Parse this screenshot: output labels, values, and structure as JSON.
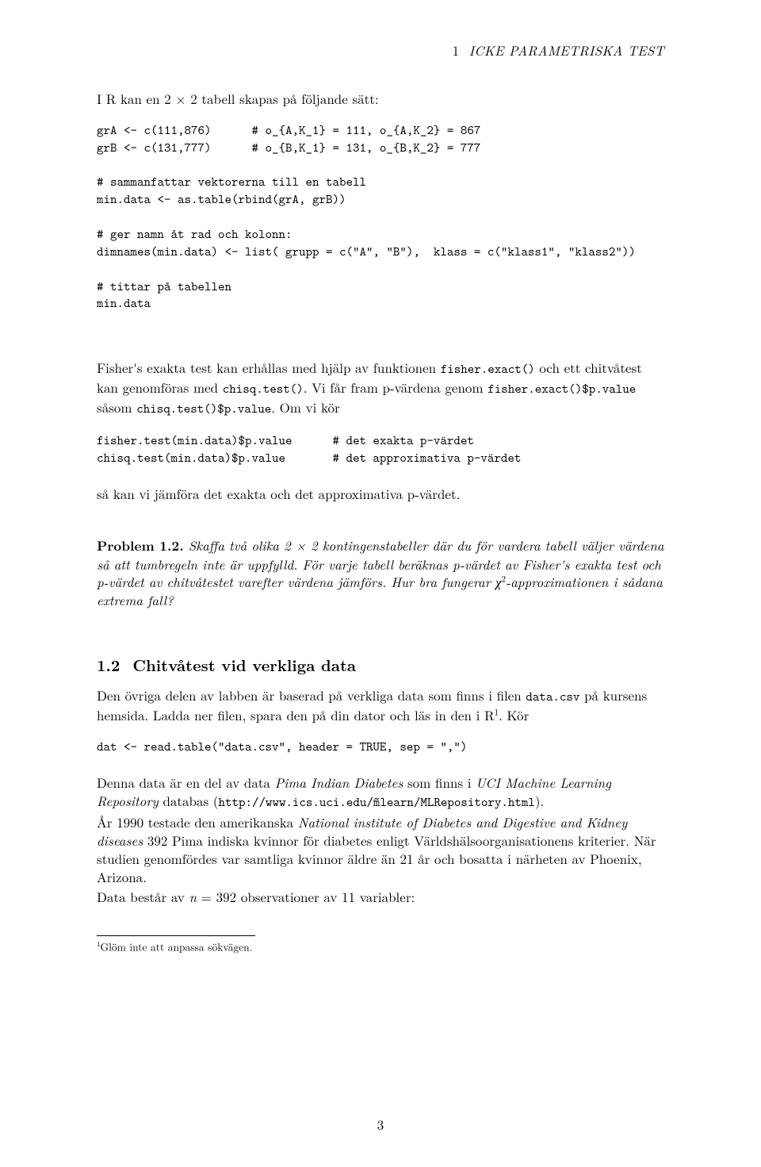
{
  "running_head": {
    "num": "1",
    "text": "ICKE PARAMETRISKA TEST"
  },
  "p_intro": "I R kan en 2 × 2 tabell skapas på följande sätt:",
  "code_block1": "grA <- c(111,876)      # o_{A,K_1} = 111, o_{A,K_2} = 867\ngrB <- c(131,777)      # o_{B,K_1} = 131, o_{B,K_2} = 777\n\n# sammanfattar vektorerna till en tabell\nmin.data <- as.table(rbind(grA, grB))\n\n# ger namn åt rad och kolonn:\ndimnames(min.data) <- list( grupp = c(\"A\", \"B\"),  klass = c(\"klass1\", \"klass2\"))\n\n# tittar på tabellen\nmin.data",
  "fisher": {
    "pre1": "Fisher's exakta test kan erhållas med hjälp av funktionen ",
    "code1": "fisher.exact()",
    "mid1": " och ett chitvåtest kan genomföras med ",
    "code2": "chisq.test()",
    "mid2": ". Vi får fram p-värdena genom ",
    "code3": "fisher.exact()$p.value",
    "mid3": " såsom ",
    "code4": "chisq.test()$p.value",
    "post": ". Om vi kör"
  },
  "code_block2": "fisher.test(min.data)$p.value      # det exakta p-värdet\nchisq.test(min.data)$p.value       # det approximativa p-värdet",
  "p_compare": "så kan vi jämföra det exakta och det approximativa p-värdet.",
  "problem": {
    "label": "Problem 1.2.",
    "body_a": " Skaffa två olika 2 × 2 kontingenstabeller där du för vardera tabell väljer värdena så att tumbregeln inte är uppfylld. För varje tabell beräknas p-värdet av Fisher's exakta test och p-värdet av chitvåtestet varefter värdena jämförs. Hur bra fungerar ",
    "chi": "χ",
    "chi_sup": "2",
    "body_b": "-approximationen i sådana extrema fall?"
  },
  "subsection": {
    "num": "1.2",
    "title": "Chitvåtest vid verkliga data"
  },
  "s1": {
    "a": "Den övriga delen av labben är baserad på verkliga data som finns i filen ",
    "code_a": "data.csv",
    "b": " på kursens hemsida. Ladda ner filen, spara den på din dator och läs in den i R",
    "fn": "1",
    "c": ". Kör"
  },
  "code_block3": "dat <- read.table(\"data.csv\", header = TRUE, sep = \",\")",
  "s2": {
    "a": "Denna data är en del av data ",
    "em_a": "Pima Indian Diabetes",
    "b": " som finns i ",
    "em_b": "UCI Machine Learning Repository",
    "c": " databas (",
    "code": "http://www.ics.uci.edu/m̃learn/MLRepository.html",
    "d": ")."
  },
  "s3": {
    "a": "År 1990 testade den amerikanska ",
    "em": "National institute of Diabetes and Digestive and Kidney diseases",
    "b": " 392 Pima indiska kvinnor för diabetes enligt Världshälsoorganisationens kriterier. När studien genomfördes var samtliga kvinnor äldre än 21 år och bosatta i närheten av Phoenix, Arizona."
  },
  "s4": {
    "a": "Data består av ",
    "math_n": "n",
    "b": " = 392 observationer av 11 variabler:"
  },
  "footnote": {
    "num": "1",
    "text": "Glöm inte att anpassa sökvägen."
  },
  "page_number": "3"
}
